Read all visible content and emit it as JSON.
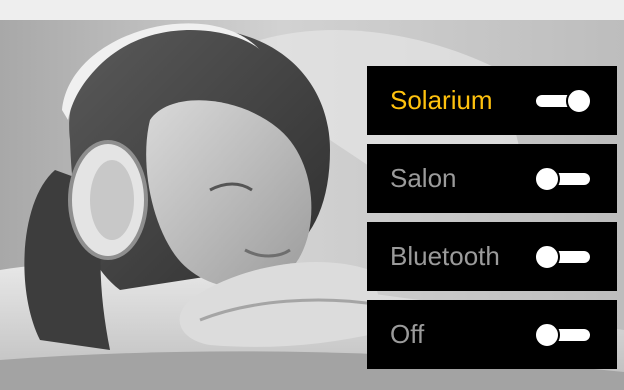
{
  "background": {
    "image_description": "grayscale-photo",
    "accent_color": "#ffc20e",
    "inactive_text_color": "#9b9b9b",
    "panel_color": "#000000"
  },
  "sources": [
    {
      "label": "Solarium",
      "active": true,
      "toggle": "on"
    },
    {
      "label": "Salon",
      "active": false,
      "toggle": "off"
    },
    {
      "label": "Bluetooth",
      "active": false,
      "toggle": "off"
    },
    {
      "label": "Off",
      "active": false,
      "toggle": "off"
    }
  ]
}
